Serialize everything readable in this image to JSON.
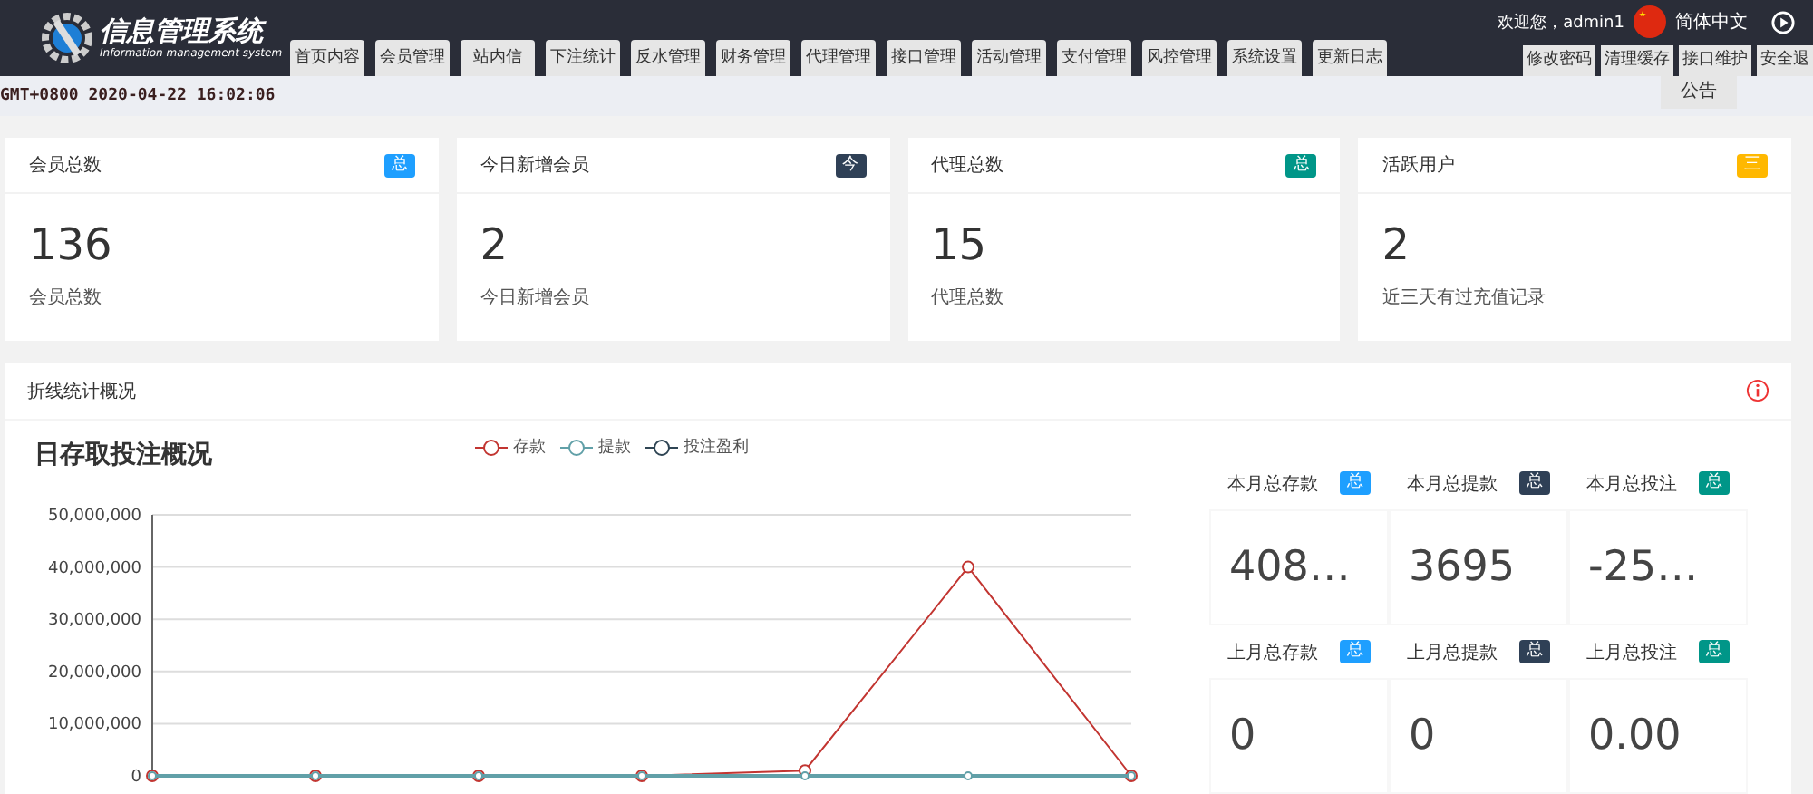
{
  "header": {
    "logo_title": "信息管理系统",
    "logo_subtitle": "Information management system",
    "tabs": [
      {
        "label": "首页内容"
      },
      {
        "label": "会员管理"
      },
      {
        "label": "站内信"
      },
      {
        "label": "下注统计"
      },
      {
        "label": "反水管理"
      },
      {
        "label": "财务管理"
      },
      {
        "label": "代理管理"
      },
      {
        "label": "接口管理"
      },
      {
        "label": "活动管理"
      },
      {
        "label": "支付管理"
      },
      {
        "label": "风控管理"
      },
      {
        "label": "系统设置"
      },
      {
        "label": "更新日志"
      }
    ],
    "welcome": "欢迎您，admin1",
    "language": "简体中文",
    "user_links": [
      {
        "label": "修改密码"
      },
      {
        "label": "清理缓存"
      },
      {
        "label": "接口维护"
      },
      {
        "label": "安全退"
      }
    ],
    "dropdown_item": "公告"
  },
  "datetime": "GMT+0800 2020-04-22 16:02:06",
  "stat_cards": [
    {
      "title": "会员总数",
      "badge": "总",
      "color": "#1e9fff",
      "value": "136",
      "caption": "会员总数"
    },
    {
      "title": "今日新增会员",
      "badge": "今",
      "color": "#2f4056",
      "value": "2",
      "caption": "今日新增会员"
    },
    {
      "title": "代理总数",
      "badge": "总",
      "color": "#009688",
      "value": "15",
      "caption": "代理总数"
    },
    {
      "title": "活跃用户",
      "badge": "三",
      "color": "#ffb800",
      "value": "2",
      "caption": "近三天有过充值记录"
    }
  ],
  "panel": {
    "title": "折线统计概况",
    "chart_data": {
      "type": "line",
      "title": "日存取投注概况",
      "ylim": [
        0,
        50000000
      ],
      "grid": true,
      "yticks": [
        {
          "value": 0,
          "label": "0"
        },
        {
          "value": 10000000,
          "label": "10,000,000"
        },
        {
          "value": 20000000,
          "label": "20,000,000"
        },
        {
          "value": 30000000,
          "label": "30,000,000"
        },
        {
          "value": 40000000,
          "label": "40,000,000"
        },
        {
          "value": 50000000,
          "label": "50,000,000"
        }
      ],
      "series": [
        {
          "name": "存款",
          "color": "#c23531",
          "marker": "circle",
          "values": [
            0,
            0,
            0,
            0,
            1000000,
            40000000,
            0
          ]
        },
        {
          "name": "提款",
          "color": "#61a0a8",
          "marker": "circle",
          "values": [
            0,
            0,
            0,
            0,
            0,
            0,
            0
          ]
        },
        {
          "name": "投注盈利",
          "color": "#2f4554",
          "marker": "circle",
          "values": [
            null,
            null,
            null,
            null,
            null,
            null,
            null
          ]
        }
      ]
    },
    "summary": [
      {
        "label": "本月总存款",
        "badge": "总",
        "color": "#1e9fff",
        "value": "408…"
      },
      {
        "label": "本月总提款",
        "badge": "总",
        "color": "#2f4056",
        "value": "3695"
      },
      {
        "label": "本月总投注",
        "badge": "总",
        "color": "#009688",
        "value": "-25…"
      },
      {
        "label": "上月总存款",
        "badge": "总",
        "color": "#1e9fff",
        "value": "0"
      },
      {
        "label": "上月总提款",
        "badge": "总",
        "color": "#2f4056",
        "value": "0"
      },
      {
        "label": "上月总投注",
        "badge": "总",
        "color": "#009688",
        "value": "0.00"
      }
    ]
  }
}
